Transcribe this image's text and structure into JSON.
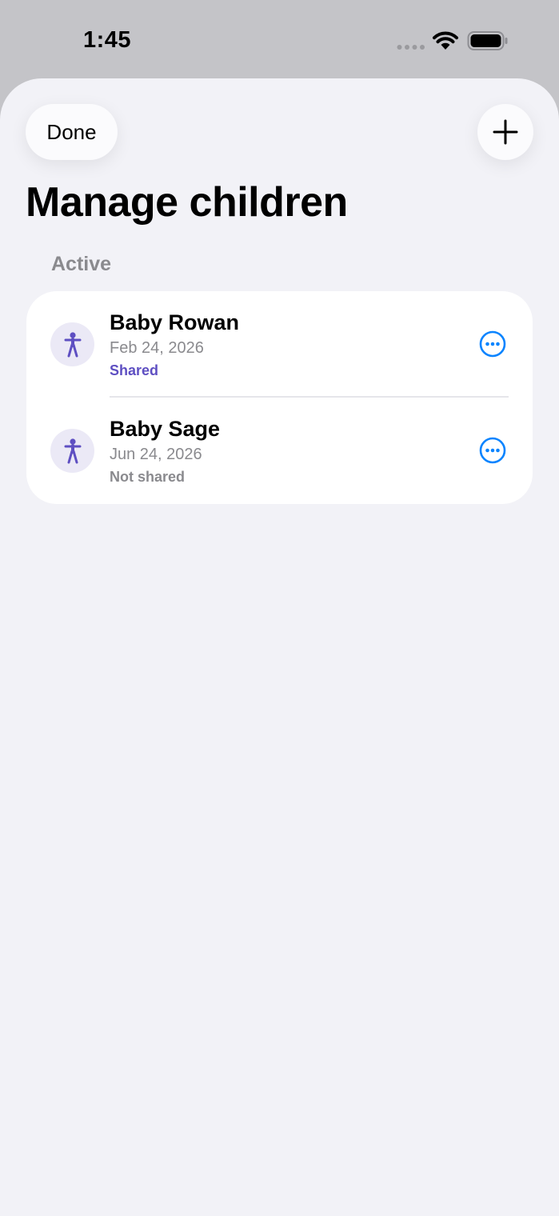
{
  "status_bar": {
    "time": "1:45"
  },
  "header": {
    "done_label": "Done",
    "add_icon": "plus-icon",
    "title": "Manage children"
  },
  "section": {
    "title": "Active"
  },
  "colors": {
    "accent_blue": "#0a84ff",
    "shared_purple": "#5e4fc2",
    "not_shared_gray": "#8a8a8e",
    "avatar_bg": "#ebe9f6"
  },
  "children": [
    {
      "name": "Baby Rowan",
      "date": "Feb 24, 2026",
      "status": "Shared",
      "status_color": "#5e4fc2",
      "icon": "person-figure-icon",
      "menu_icon": "ellipsis-circle-icon"
    },
    {
      "name": "Baby Sage",
      "date": "Jun 24, 2026",
      "status": "Not shared",
      "status_color": "#8a8a8e",
      "icon": "person-figure-icon",
      "menu_icon": "ellipsis-circle-icon"
    }
  ]
}
